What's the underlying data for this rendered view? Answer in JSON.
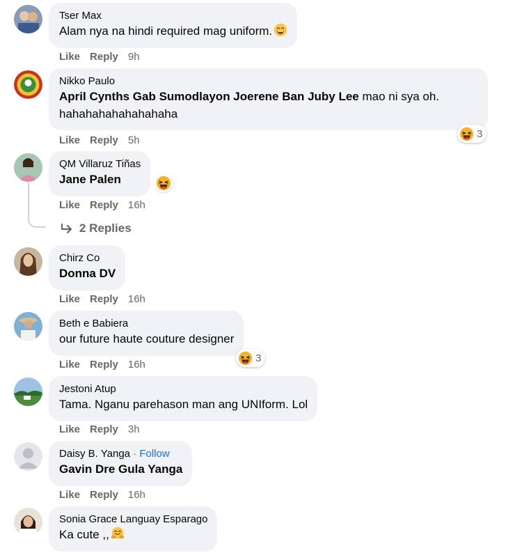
{
  "comments": [
    {
      "author": "Tser Max",
      "text": "Alam nya na hindi required mag uniform.",
      "like": "Like",
      "reply": "Reply",
      "time": "9h",
      "emoji": "smile-icon"
    },
    {
      "author": "Nikko Paulo",
      "tags": "April Cynths Gab Sumodlayon Joerene Ban Juby Lee",
      "text": " mao ni sya oh.",
      "text2": "hahahahahahahahaha",
      "like": "Like",
      "reply": "Reply",
      "time": "5h",
      "reaction_count": "3",
      "reaction": "haha-icon"
    },
    {
      "author": "QM Villaruz Tiñas",
      "tags": "Jane Palen",
      "like": "Like",
      "reply": "Reply",
      "time": "16h",
      "reaction": "haha-icon",
      "replies_label": "2 Replies"
    },
    {
      "author": "Chirz Co",
      "tags": "Donna DV",
      "like": "Like",
      "reply": "Reply",
      "time": "16h"
    },
    {
      "author": "Beth e Babiera",
      "text": "our future haute couture designer",
      "like": "Like",
      "reply": "Reply",
      "time": "16h",
      "reaction_count": "3",
      "reaction": "haha-icon"
    },
    {
      "author": "Jestoni Atup",
      "text": "Tama. Nganu parehason man ang UNIform. Lol",
      "like": "Like",
      "reply": "Reply",
      "time": "3h"
    },
    {
      "author": "Daisy B. Yanga",
      "separator": " · ",
      "follow": "Follow",
      "tags": "Gavin Dre Gula Yanga",
      "like": "Like",
      "reply": "Reply",
      "time": "16h"
    },
    {
      "author": "Sonia Grace Languay Esparago",
      "text": "Ka cute ,,",
      "emoji": "hugging-face-icon"
    }
  ],
  "colors": {
    "bubble": "#f0f2f5",
    "meta": "#65676b",
    "follow": "#216fdb",
    "haha": "#f7b125"
  }
}
